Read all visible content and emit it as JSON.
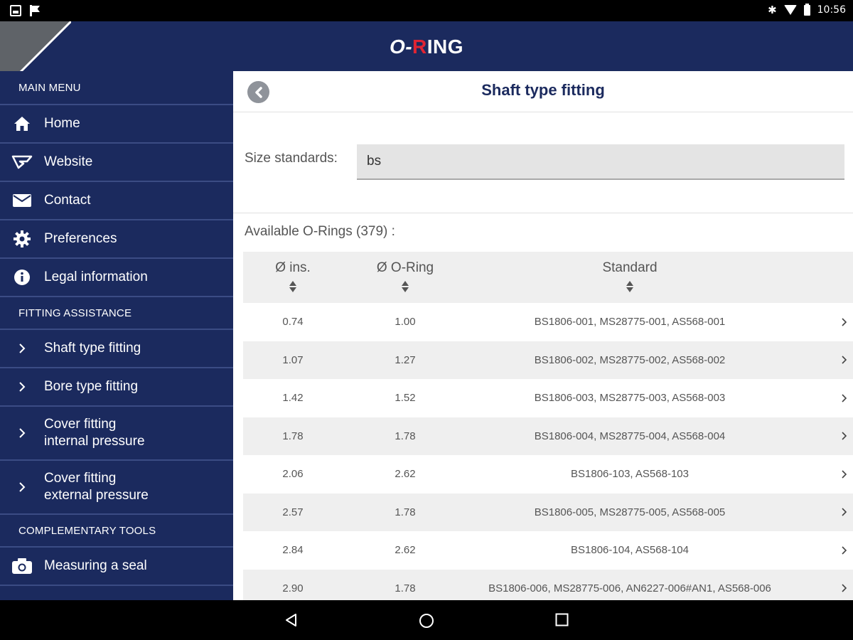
{
  "status_bar": {
    "time": "10:56",
    "icons": [
      "image-icon",
      "flag-icon",
      "bluetooth-icon",
      "wifi-icon",
      "battery-icon"
    ]
  },
  "app": {
    "logo_prefix": "O-",
    "logo_accent": "R",
    "logo_suffix": "ING",
    "brand_color": "#1b2a5e",
    "accent_color": "#e02433"
  },
  "sidebar": {
    "main_menu_heading": "MAIN MENU",
    "main_items": [
      {
        "label": "Home",
        "icon": "home-icon"
      },
      {
        "label": "Website",
        "icon": "website-icon"
      },
      {
        "label": "Contact",
        "icon": "envelope-icon"
      },
      {
        "label": "Preferences",
        "icon": "gear-icon"
      },
      {
        "label": "Legal information",
        "icon": "info-icon"
      }
    ],
    "fitting_heading": "FITTING ASSISTANCE",
    "fitting_items": [
      {
        "label": "Shaft type fitting",
        "icon": "chevron-right-icon"
      },
      {
        "label": "Bore type fitting",
        "icon": "chevron-right-icon"
      },
      {
        "label": "Cover fitting\ninternal pressure",
        "icon": "chevron-right-icon"
      },
      {
        "label": "Cover fitting\nexternal pressure",
        "icon": "chevron-right-icon"
      }
    ],
    "tools_heading": "COMPLEMENTARY TOOLS",
    "tools_items": [
      {
        "label": "Measuring a seal",
        "icon": "camera-icon"
      }
    ]
  },
  "main": {
    "title": "Shaft type fitting",
    "size_standards_label": "Size standards:",
    "size_standards_value": "bs",
    "available_label": "Available O-Rings (379) :",
    "table": {
      "headers": [
        "Ø ins.",
        "Ø O-Ring",
        "Standard"
      ],
      "rows": [
        [
          "0.74",
          "1.00",
          "BS1806-001, MS28775-001, AS568-001"
        ],
        [
          "1.07",
          "1.27",
          "BS1806-002, MS28775-002, AS568-002"
        ],
        [
          "1.42",
          "1.52",
          "BS1806-003, MS28775-003, AS568-003"
        ],
        [
          "1.78",
          "1.78",
          "BS1806-004, MS28775-004, AS568-004"
        ],
        [
          "2.06",
          "2.62",
          "BS1806-103, AS568-103"
        ],
        [
          "2.57",
          "1.78",
          "BS1806-005, MS28775-005, AS568-005"
        ],
        [
          "2.84",
          "2.62",
          "BS1806-104, AS568-104"
        ],
        [
          "2.90",
          "1.78",
          "BS1806-006, MS28775-006, AN6227-006#AN1, AS568-006"
        ]
      ]
    }
  },
  "nav_bar": {
    "buttons": [
      "back-nav-icon",
      "home-nav-icon",
      "recents-nav-icon"
    ]
  }
}
